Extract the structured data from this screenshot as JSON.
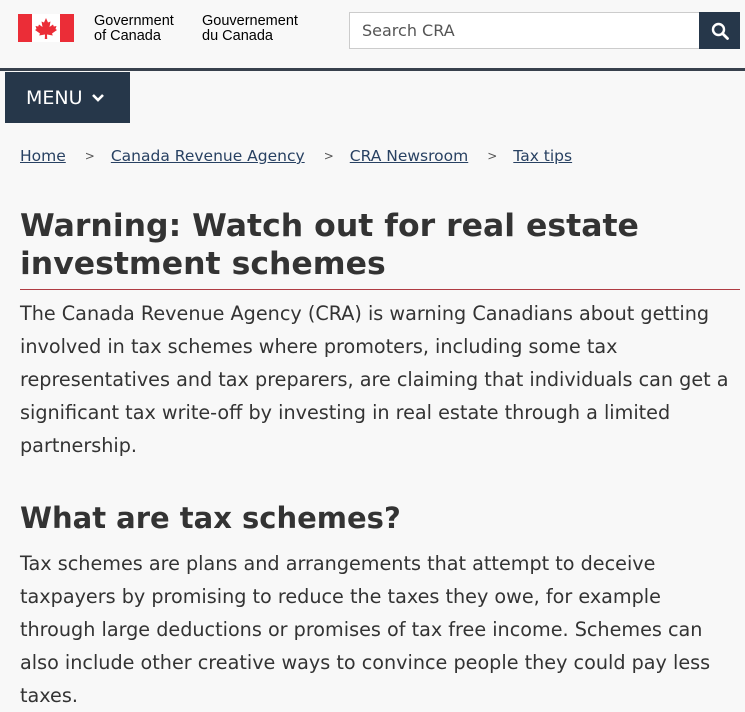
{
  "header": {
    "government_en": "Government\nof Canada",
    "government_fr": "Gouvernement\ndu Canada",
    "search": {
      "placeholder": "Search CRA",
      "value": ""
    }
  },
  "menu": {
    "label": "MENU"
  },
  "breadcrumb": [
    "Home",
    "Canada Revenue Agency",
    "CRA Newsroom",
    "Tax tips"
  ],
  "breadcrumb_separator": ">",
  "main": {
    "title": "Warning: Watch out for real estate investment schemes",
    "intro": "The Canada Revenue Agency (CRA) is warning Canadians about getting involved in tax schemes where promoters, including some tax representatives and tax preparers, are claiming that individuals can get a significant tax write-off by investing in real estate through a limited partnership.",
    "section_heading": "What are tax schemes?",
    "section_text": "Tax schemes are plans and arrangements that attempt to deceive taxpayers by promising to reduce the taxes they owe, for example through large deductions or promises of tax free income. Schemes can also include other creative ways to convince people they could pay less taxes."
  },
  "icons": {
    "flag": "canada-flag-icon",
    "search": "search-icon",
    "menu_chevron": "chevron-down-icon"
  },
  "colors": {
    "navy": "#26374a",
    "link": "#284162",
    "flag_red": "#eb2d37",
    "title_rule": "#af3c43"
  }
}
